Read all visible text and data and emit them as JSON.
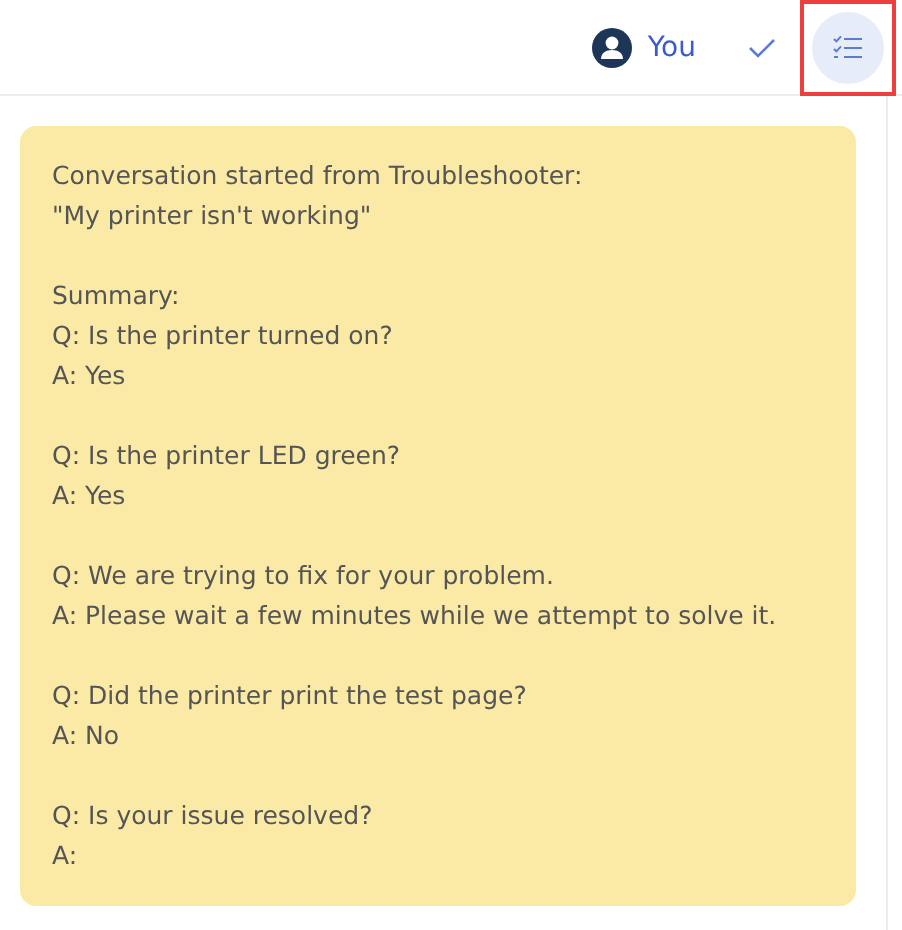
{
  "header": {
    "user": {
      "name": "You"
    },
    "sent": true,
    "summary_button": {
      "highlighted": true
    }
  },
  "message": {
    "blocks": [
      {
        "lines": [
          "Conversation started from Troubleshooter:",
          "\"My printer isn't working\""
        ]
      },
      {
        "lines": [
          "Summary:",
          "Q: Is the printer turned on?",
          "A: Yes"
        ]
      },
      {
        "lines": [
          "Q: Is the printer LED green?",
          "A: Yes"
        ]
      },
      {
        "lines": [
          "Q: We are trying to fix for your problem.",
          "A: Please wait a few minutes while we attempt to solve it."
        ]
      },
      {
        "lines": [
          "Q: Did the printer print the test page?",
          "A: No"
        ]
      },
      {
        "lines": [
          "Q: Is your issue resolved?",
          "A:"
        ]
      }
    ]
  }
}
